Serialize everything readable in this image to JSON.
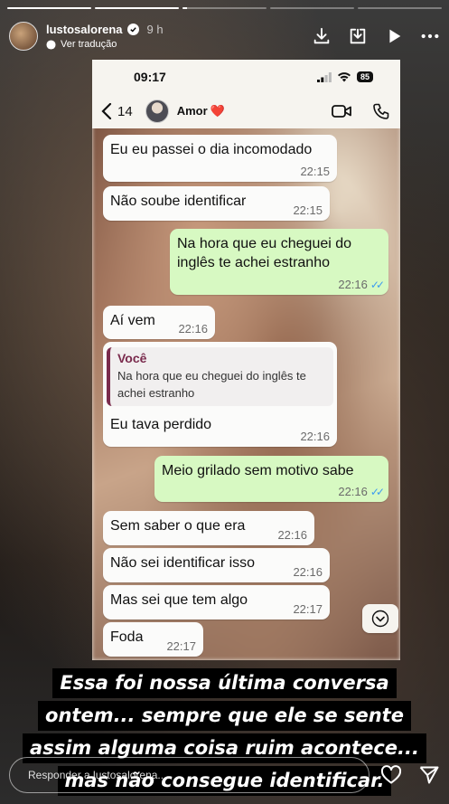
{
  "story": {
    "progress": [
      1,
      1,
      0.05,
      0,
      0
    ],
    "username": "lustosalorena",
    "time_ago": "9 h",
    "translate_label": "Ver tradução",
    "reply_placeholder": "Responder a lustosalorena..."
  },
  "phone": {
    "clock": "09:17",
    "battery": "85",
    "back_count": "14",
    "contact_name": "Amor",
    "contact_emoji": "❤️"
  },
  "messages": [
    {
      "dir": "in",
      "text": "Eu eu passei o dia incomodado",
      "time": "22:15"
    },
    {
      "dir": "in",
      "text": "Não soube identificar",
      "time": "22:15"
    },
    {
      "dir": "out",
      "text": "Na hora que eu cheguei do inglês te achei estranho",
      "time": "22:16"
    },
    {
      "dir": "in",
      "text": "Aí vem",
      "time": "22:16"
    },
    {
      "dir": "in",
      "quote_author": "Você",
      "quote_text": "Na hora que eu cheguei do inglês te achei estranho",
      "text": "Eu tava perdido",
      "time": "22:16"
    },
    {
      "dir": "out",
      "text": "Meio grilado sem motivo sabe",
      "time": "22:16"
    },
    {
      "dir": "in",
      "text": "Sem saber o que era",
      "time": "22:16"
    },
    {
      "dir": "in",
      "text": "Não sei identificar isso",
      "time": "22:16"
    },
    {
      "dir": "in",
      "text": "Mas sei que tem algo",
      "time": "22:17"
    },
    {
      "dir": "in",
      "text": "Foda",
      "time": "22:17"
    }
  ],
  "caption": [
    "Essa foi nossa última conversa",
    "ontem... sempre que ele se sente",
    "assim alguma coisa ruim acontece...",
    "mas não consegue identificar."
  ],
  "colors": {
    "outgoing_bubble": "#d7f9c2",
    "incoming_bubble": "#fbfbfa",
    "quote_accent": "#7a2b4d",
    "read_ticks": "#3c9bf0"
  }
}
